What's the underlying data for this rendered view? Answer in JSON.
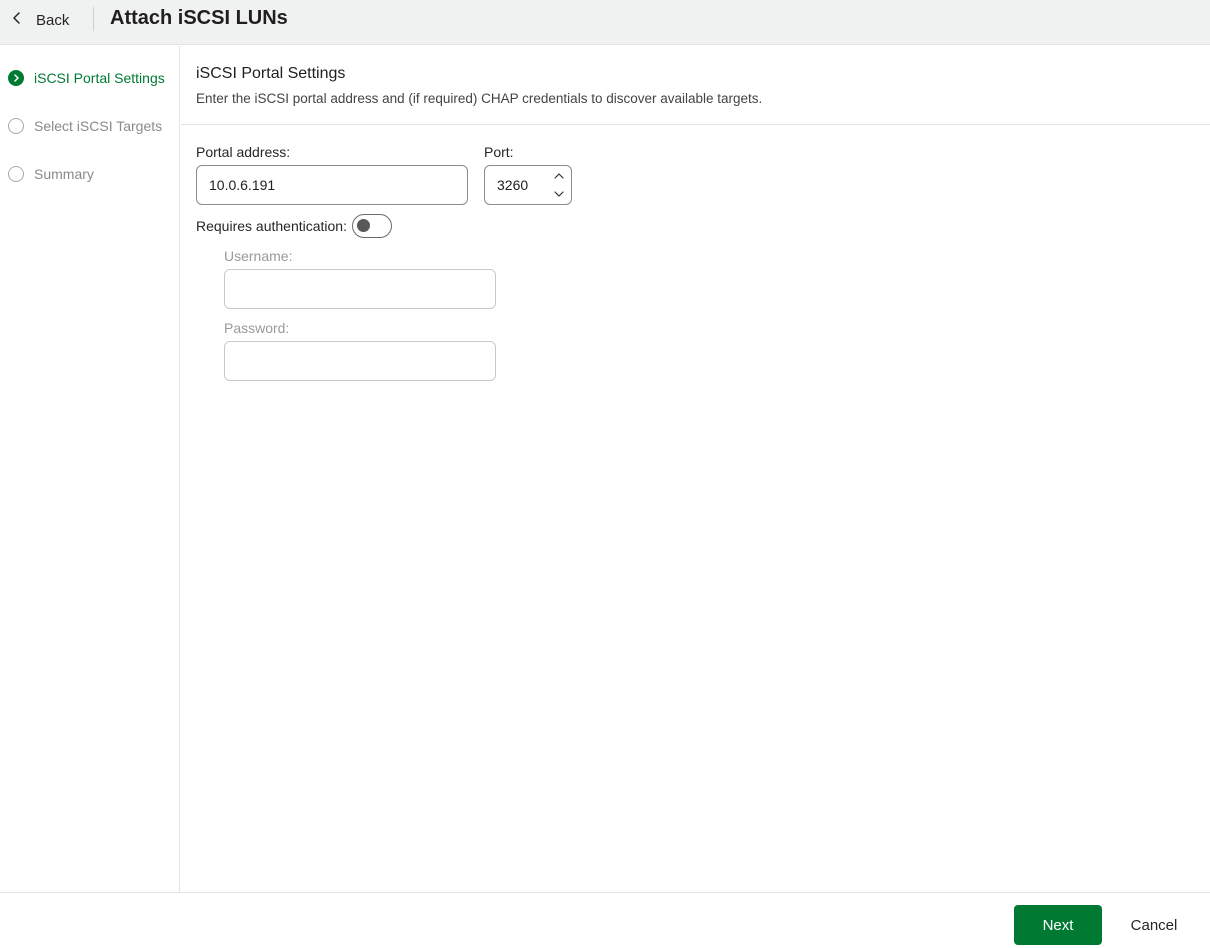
{
  "header": {
    "back_label": "Back",
    "title": "Attach iSCSI LUNs",
    "back_icon": "chevron-left-icon"
  },
  "wizard_steps": [
    {
      "label": "iSCSI Portal Settings",
      "state": "active",
      "icon": "chevron-right-icon"
    },
    {
      "label": "Select iSCSI Targets",
      "state": "pending",
      "icon": "empty-circle-icon"
    },
    {
      "label": "Summary",
      "state": "pending",
      "icon": "empty-circle-icon"
    }
  ],
  "main": {
    "section_title": "iSCSI Portal Settings",
    "section_description": "Enter the iSCSI portal address and (if required) CHAP credentials to discover available targets.",
    "portal_address": {
      "label": "Portal address:",
      "value": "10.0.6.191"
    },
    "port": {
      "label": "Port:",
      "value": "3260"
    },
    "requires_auth": {
      "label": "Requires authentication:",
      "enabled": false
    },
    "username": {
      "label": "Username:",
      "value": ""
    },
    "password": {
      "label": "Password:",
      "value": ""
    }
  },
  "footer": {
    "next_label": "Next",
    "cancel_label": "Cancel"
  },
  "colors": {
    "accent": "#007a33",
    "header_bg": "#f0f1f1",
    "border": "#e3e4e4"
  }
}
